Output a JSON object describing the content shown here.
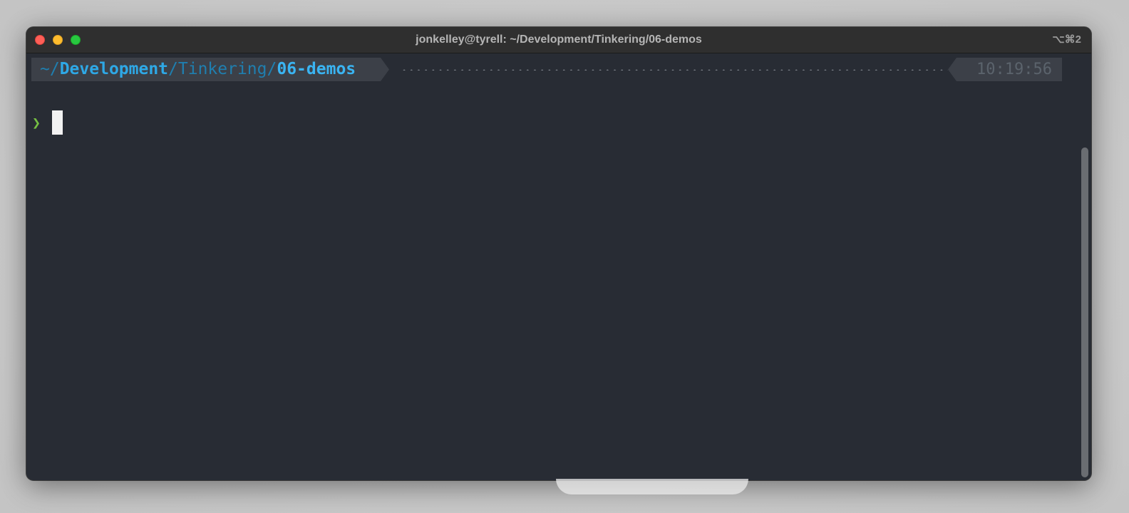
{
  "window": {
    "title": "jonkelley@tyrell: ~/Development/Tinkering/06-demos",
    "shortcut": "⌥⌘2"
  },
  "prompt": {
    "path_segments": [
      {
        "text": "~/",
        "style": "dim"
      },
      {
        "text": "Development",
        "style": "bright"
      },
      {
        "text": "/Tinkering/",
        "style": "dim"
      },
      {
        "text": "06-demos",
        "style": "last"
      }
    ],
    "time": "10:19:56",
    "symbol": "❯"
  },
  "colors": {
    "terminal_bg": "#282c34",
    "segment_bg": "#3c4048",
    "path_dim": "#1f7fb0",
    "path_bright": "#2ea8e6",
    "time": "#5b636c",
    "prompt_symbol": "#76c043",
    "traffic_close": "#fe5f57",
    "traffic_minimize": "#febc2e",
    "traffic_zoom": "#28c840"
  },
  "icons": {
    "close": "close-icon",
    "minimize": "minimize-icon",
    "zoom": "zoom-icon"
  }
}
